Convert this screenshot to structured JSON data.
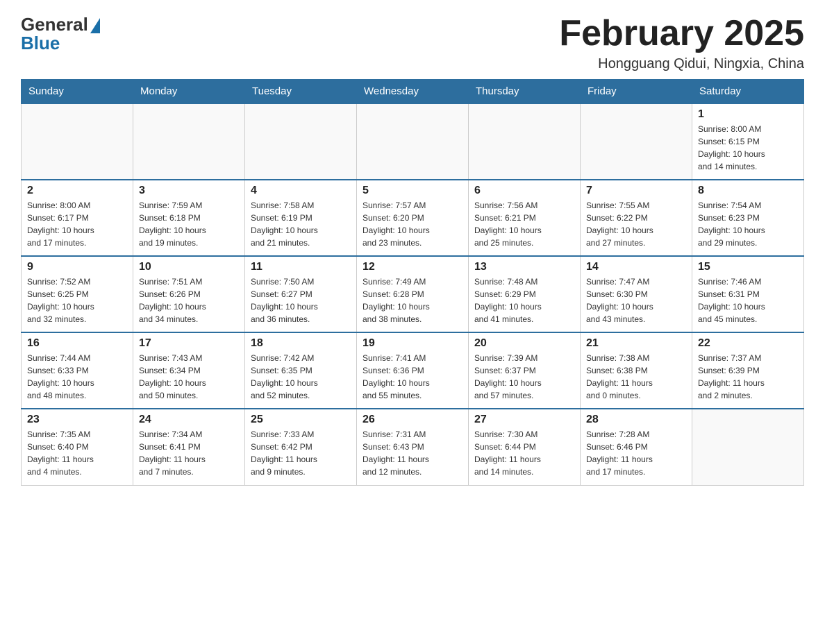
{
  "header": {
    "logo_general": "General",
    "logo_blue": "Blue",
    "month_title": "February 2025",
    "location": "Hongguang Qidui, Ningxia, China"
  },
  "weekdays": [
    "Sunday",
    "Monday",
    "Tuesday",
    "Wednesday",
    "Thursday",
    "Friday",
    "Saturday"
  ],
  "weeks": [
    [
      {
        "day": "",
        "info": ""
      },
      {
        "day": "",
        "info": ""
      },
      {
        "day": "",
        "info": ""
      },
      {
        "day": "",
        "info": ""
      },
      {
        "day": "",
        "info": ""
      },
      {
        "day": "",
        "info": ""
      },
      {
        "day": "1",
        "info": "Sunrise: 8:00 AM\nSunset: 6:15 PM\nDaylight: 10 hours\nand 14 minutes."
      }
    ],
    [
      {
        "day": "2",
        "info": "Sunrise: 8:00 AM\nSunset: 6:17 PM\nDaylight: 10 hours\nand 17 minutes."
      },
      {
        "day": "3",
        "info": "Sunrise: 7:59 AM\nSunset: 6:18 PM\nDaylight: 10 hours\nand 19 minutes."
      },
      {
        "day": "4",
        "info": "Sunrise: 7:58 AM\nSunset: 6:19 PM\nDaylight: 10 hours\nand 21 minutes."
      },
      {
        "day": "5",
        "info": "Sunrise: 7:57 AM\nSunset: 6:20 PM\nDaylight: 10 hours\nand 23 minutes."
      },
      {
        "day": "6",
        "info": "Sunrise: 7:56 AM\nSunset: 6:21 PM\nDaylight: 10 hours\nand 25 minutes."
      },
      {
        "day": "7",
        "info": "Sunrise: 7:55 AM\nSunset: 6:22 PM\nDaylight: 10 hours\nand 27 minutes."
      },
      {
        "day": "8",
        "info": "Sunrise: 7:54 AM\nSunset: 6:23 PM\nDaylight: 10 hours\nand 29 minutes."
      }
    ],
    [
      {
        "day": "9",
        "info": "Sunrise: 7:52 AM\nSunset: 6:25 PM\nDaylight: 10 hours\nand 32 minutes."
      },
      {
        "day": "10",
        "info": "Sunrise: 7:51 AM\nSunset: 6:26 PM\nDaylight: 10 hours\nand 34 minutes."
      },
      {
        "day": "11",
        "info": "Sunrise: 7:50 AM\nSunset: 6:27 PM\nDaylight: 10 hours\nand 36 minutes."
      },
      {
        "day": "12",
        "info": "Sunrise: 7:49 AM\nSunset: 6:28 PM\nDaylight: 10 hours\nand 38 minutes."
      },
      {
        "day": "13",
        "info": "Sunrise: 7:48 AM\nSunset: 6:29 PM\nDaylight: 10 hours\nand 41 minutes."
      },
      {
        "day": "14",
        "info": "Sunrise: 7:47 AM\nSunset: 6:30 PM\nDaylight: 10 hours\nand 43 minutes."
      },
      {
        "day": "15",
        "info": "Sunrise: 7:46 AM\nSunset: 6:31 PM\nDaylight: 10 hours\nand 45 minutes."
      }
    ],
    [
      {
        "day": "16",
        "info": "Sunrise: 7:44 AM\nSunset: 6:33 PM\nDaylight: 10 hours\nand 48 minutes."
      },
      {
        "day": "17",
        "info": "Sunrise: 7:43 AM\nSunset: 6:34 PM\nDaylight: 10 hours\nand 50 minutes."
      },
      {
        "day": "18",
        "info": "Sunrise: 7:42 AM\nSunset: 6:35 PM\nDaylight: 10 hours\nand 52 minutes."
      },
      {
        "day": "19",
        "info": "Sunrise: 7:41 AM\nSunset: 6:36 PM\nDaylight: 10 hours\nand 55 minutes."
      },
      {
        "day": "20",
        "info": "Sunrise: 7:39 AM\nSunset: 6:37 PM\nDaylight: 10 hours\nand 57 minutes."
      },
      {
        "day": "21",
        "info": "Sunrise: 7:38 AM\nSunset: 6:38 PM\nDaylight: 11 hours\nand 0 minutes."
      },
      {
        "day": "22",
        "info": "Sunrise: 7:37 AM\nSunset: 6:39 PM\nDaylight: 11 hours\nand 2 minutes."
      }
    ],
    [
      {
        "day": "23",
        "info": "Sunrise: 7:35 AM\nSunset: 6:40 PM\nDaylight: 11 hours\nand 4 minutes."
      },
      {
        "day": "24",
        "info": "Sunrise: 7:34 AM\nSunset: 6:41 PM\nDaylight: 11 hours\nand 7 minutes."
      },
      {
        "day": "25",
        "info": "Sunrise: 7:33 AM\nSunset: 6:42 PM\nDaylight: 11 hours\nand 9 minutes."
      },
      {
        "day": "26",
        "info": "Sunrise: 7:31 AM\nSunset: 6:43 PM\nDaylight: 11 hours\nand 12 minutes."
      },
      {
        "day": "27",
        "info": "Sunrise: 7:30 AM\nSunset: 6:44 PM\nDaylight: 11 hours\nand 14 minutes."
      },
      {
        "day": "28",
        "info": "Sunrise: 7:28 AM\nSunset: 6:46 PM\nDaylight: 11 hours\nand 17 minutes."
      },
      {
        "day": "",
        "info": ""
      }
    ]
  ]
}
